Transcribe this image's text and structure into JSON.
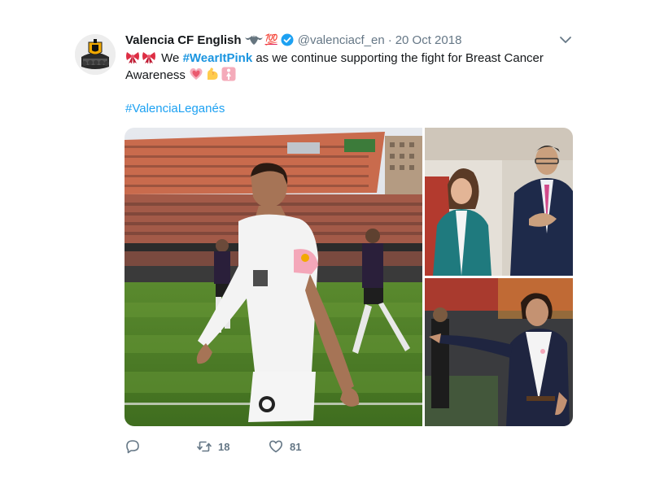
{
  "tweet": {
    "author_name": "Valencia CF English",
    "author_emoji_1": "bat-icon",
    "author_emoji_2": "💯",
    "verified": true,
    "handle": "@valenciacf_en",
    "separator": "·",
    "date": "20 Oct 2018",
    "text_emojis_lead": [
      "ribbon-icon",
      "ribbon-icon"
    ],
    "text_we": "We",
    "hashtag_bold": "#WearItPink",
    "text_rest": "as we continue supporting the fight for Breast Cancer Awareness",
    "text_emojis_trail": [
      "pink-heart-icon",
      "flexed-biceps-icon",
      "womens-symbol-icon"
    ],
    "hashtag_2": "#ValenciaLeganés",
    "actions": {
      "reply_icon": "reply-icon",
      "retweet_count": "18",
      "like_count": "81"
    },
    "media": {
      "photos": [
        "player-stadium-photo",
        "woman-man-stand-photo",
        "coach-pointing-photo"
      ]
    },
    "colors": {
      "link": "#1da1f2",
      "text": "#14171a",
      "secondary": "#657786",
      "verified": "#1da1f2"
    }
  }
}
